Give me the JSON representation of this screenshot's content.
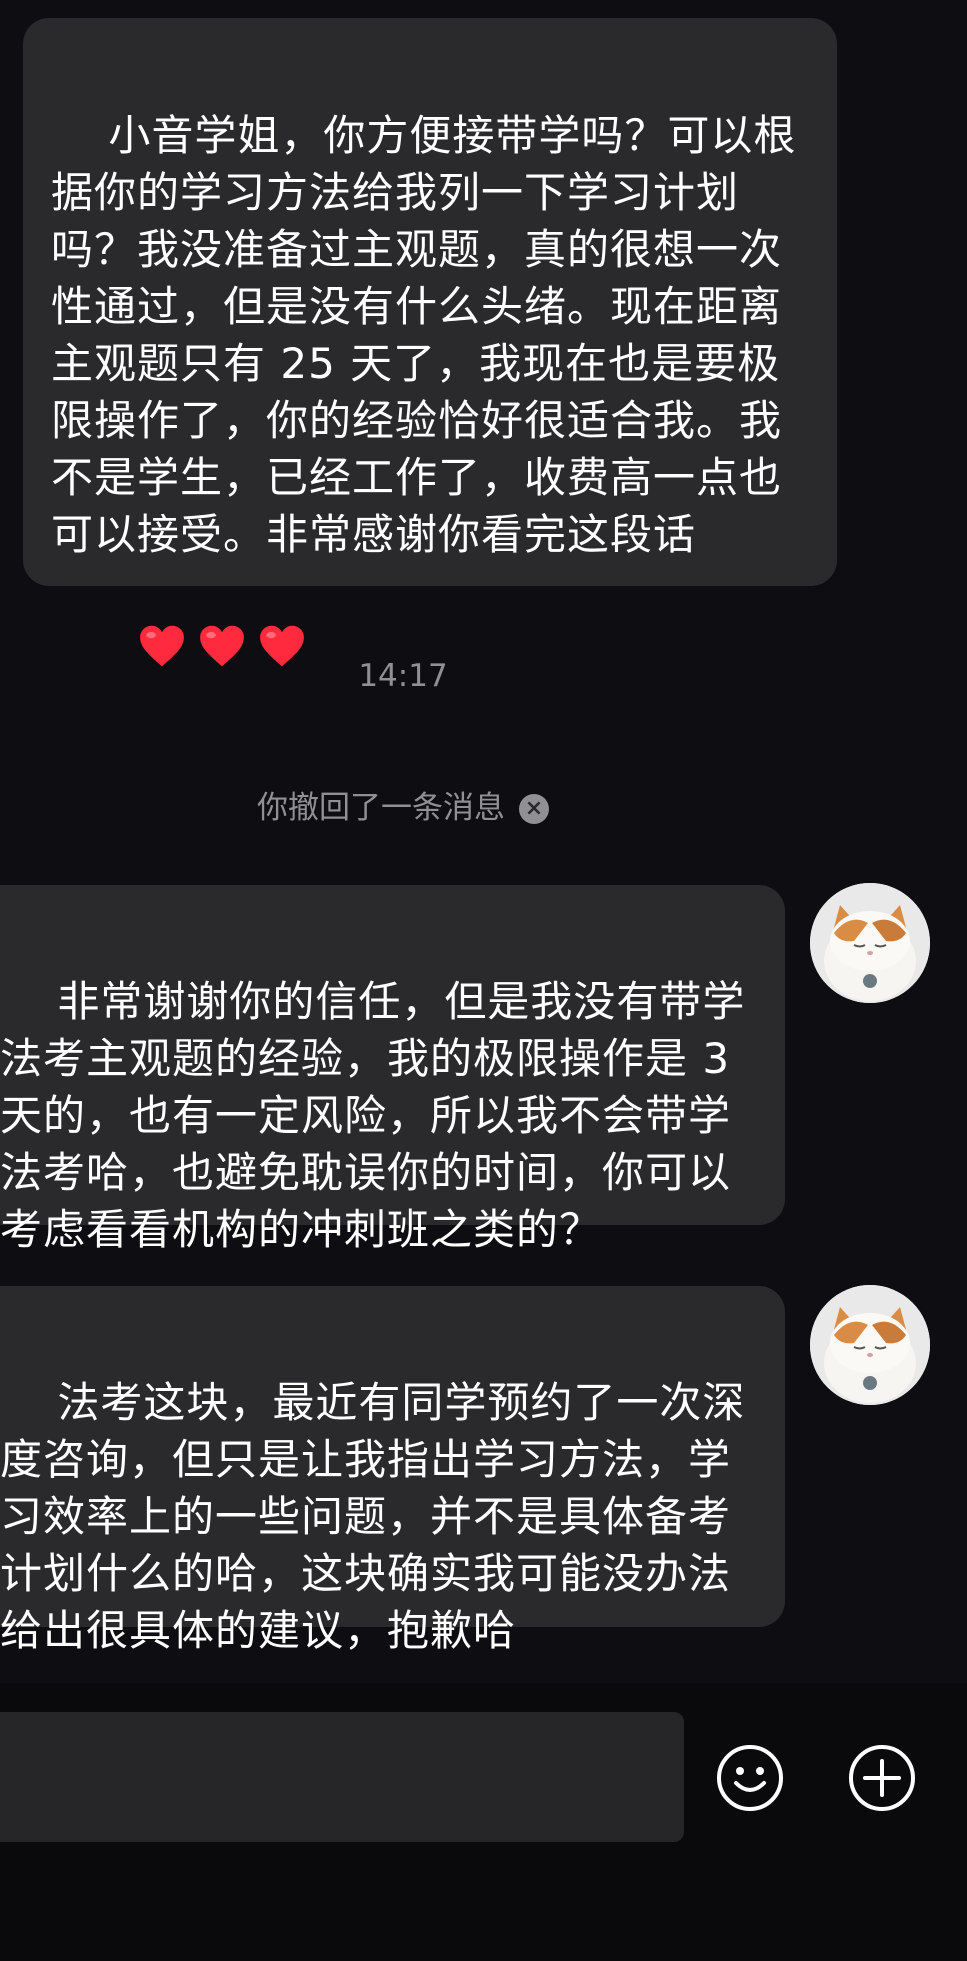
{
  "messages": {
    "received_text": "小音学姐，你方便接带学吗？可以根据你的学习方法给我列一下学习计划吗？我没准备过主观题，真的很想一次性通过，但是没有什么头绪。现在距离主观题只有 25 天了，我现在也是要极限操作了，你的经验恰好很适合我。我不是学生，已经工作了，收费高一点也可以接受。非常感谢你看完这段话",
    "received_emoji": "❤️❤️❤️",
    "timestamp": "14:17",
    "recall_notice": "你撤回了一条消息",
    "sent_1_text": "非常谢谢你的信任，但是我没有带学法考主观题的经验，我的极限操作是 3 天的，也有一定风险，所以我不会带学法考哈，也避免耽误你的时间，你可以考虑看看机构的冲刺班之类的？",
    "sent_2_text": "法考这块，最近有同学预约了一次深度咨询，但只是让我指出学习方法，学习效率上的一些问题，并不是具体备考计划什么的哈，这块确实我可能没办法给出很具体的建议，抱歉哈"
  },
  "input_bar": {
    "input_value": "",
    "emoji_icon": "smiley-face-icon",
    "plus_icon": "plus-circle-icon"
  },
  "colors": {
    "background": "#0e0e12",
    "bubble": "#2a2a2c",
    "muted_text": "#8f8f94",
    "heart": "#ff2a3d"
  }
}
